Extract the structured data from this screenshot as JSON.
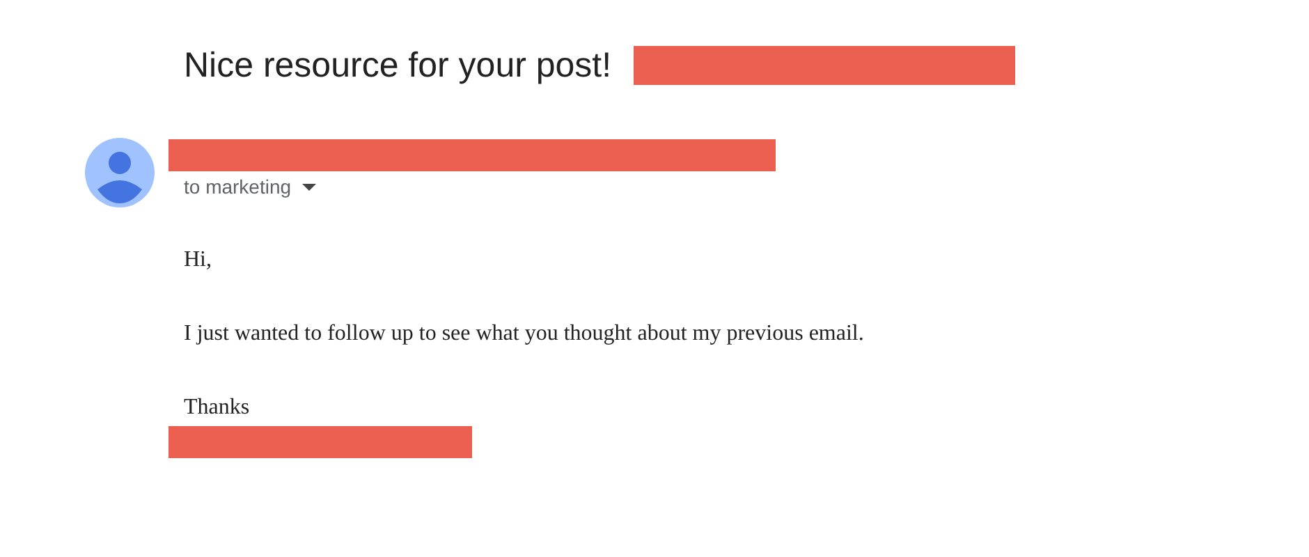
{
  "subject": {
    "text": "Nice resource for your post!",
    "label_redacted": true
  },
  "sender": {
    "name_redacted": true,
    "recipient": "to marketing",
    "details_expanded": false
  },
  "body": {
    "paragraphs": [
      "Hi,",
      "I just wanted to follow up to see what you thought about my previous email.",
      "Thanks"
    ],
    "signature_redacted": true
  }
}
